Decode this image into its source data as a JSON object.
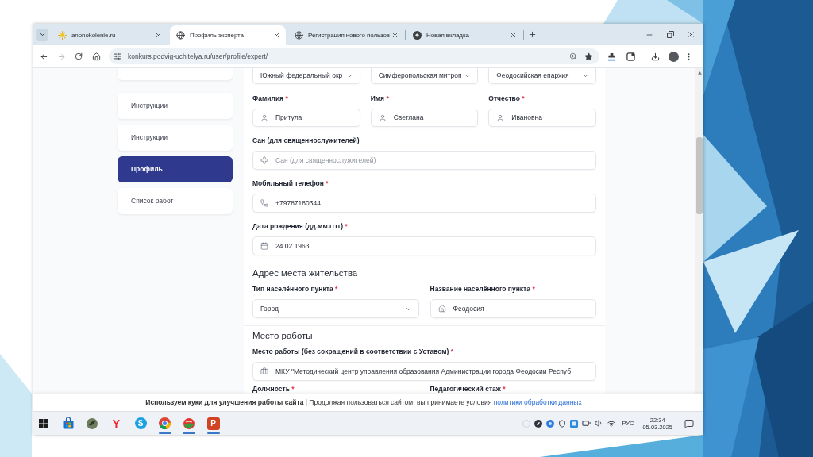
{
  "browser": {
    "tabs": [
      {
        "title": "anonokolenie.ru",
        "selected": false
      },
      {
        "title": "Профиль эксперта",
        "selected": true
      },
      {
        "title": "Регистрация нового пользов",
        "selected": false
      },
      {
        "title": "Новая вкладка",
        "selected": false
      }
    ],
    "navigation": {
      "forward_disabled": true
    },
    "address": "konkurs.podvig-uchitelya.ru/user/profile/expert/"
  },
  "sidebar": {
    "items": [
      {
        "label": "Инструкции",
        "selected": false
      },
      {
        "label": "Инструкции",
        "selected": false
      },
      {
        "label": "Профиль",
        "selected": true
      },
      {
        "label": "Список работ",
        "selected": false
      }
    ]
  },
  "form": {
    "top_selects": [
      {
        "value": "Южный федеральный окр"
      },
      {
        "value": "Симферопольская митроп"
      },
      {
        "value": "Феодосийская епархия"
      }
    ],
    "name_fields": [
      {
        "label": "Фамилия",
        "required_mark": "*",
        "value": "Притула"
      },
      {
        "label": "Имя",
        "required_mark": "*",
        "value": "Светлана"
      },
      {
        "label": "Отчество",
        "required_mark": "*",
        "value": "Ивановна"
      }
    ],
    "fields": [
      {
        "label": "Сан (для священнослужителей)",
        "placeholder": "Сан (для священнослужителей)"
      },
      {
        "label": "Мобильный телефон",
        "required_mark": "*",
        "value": "+79787180344"
      },
      {
        "label": "Дата рождения (дд.мм.гггг)",
        "required_mark": "*",
        "value": "24.02.1963"
      }
    ],
    "sections": [
      {
        "title": "Адрес места жительства",
        "fields": [
          {
            "kind": "select",
            "label": "Тип населённого пункта",
            "required_mark": "*",
            "value": "Город"
          },
          {
            "kind": "input",
            "label": "Название населённого пункта",
            "required_mark": "*",
            "value": "Феодосия"
          }
        ]
      },
      {
        "title": "Место работы",
        "fields": [
          {
            "kind": "input",
            "label": "Место работы (без сокращений в соответствии с Уставом)",
            "required_mark": "*",
            "value": "МКУ \"Методический центр управления образования Администрации города Феодосии Респуб"
          }
        ]
      }
    ],
    "next_labels": [
      {
        "label": "Должность",
        "required_mark": "*"
      },
      {
        "label": "Педагогический стаж",
        "required_mark": "*"
      }
    ]
  },
  "cookie_banner": {
    "text": "**Используем куки для улучшения работы сайта** | Продолжая пользоваться сайтом, вы принимаете условия",
    "link": "политики обработки данных"
  },
  "taskbar": {
    "apps": [
      {
        "kind": "start",
        "open": false
      },
      {
        "kind": "store",
        "open": false
      },
      {
        "kind": "app",
        "open": false
      },
      {
        "kind": "letter",
        "glyph": "Y",
        "open": false
      },
      {
        "kind": "disc",
        "glyph": "S",
        "open": false
      },
      {
        "kind": "browser",
        "open": true
      },
      {
        "kind": "ball",
        "open": true
      },
      {
        "kind": "tile",
        "glyph": "P",
        "open": true
      }
    ],
    "language": "РУС",
    "time": "22:34",
    "date": "05.03.2025"
  }
}
